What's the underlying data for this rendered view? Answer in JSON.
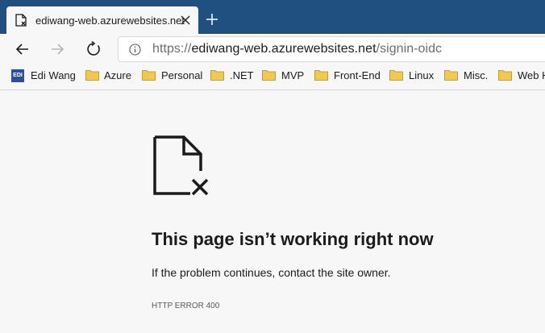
{
  "tab": {
    "title": "ediwang-web.azurewebsites.net",
    "icon": "page-icon",
    "close_icon": "close-icon"
  },
  "toolbar": {
    "back_icon": "back-arrow-icon",
    "forward_icon": "forward-arrow-icon",
    "refresh_icon": "refresh-icon",
    "info_icon": "info-icon"
  },
  "address": {
    "protocol": "https://",
    "host": "ediwang-web.azurewebsites.net",
    "path": "/signin-oidc"
  },
  "bookmarks": [
    {
      "label": "Edi Wang",
      "icon": "edi-logo",
      "logo_text": "EDI"
    },
    {
      "label": "Azure",
      "icon": "folder-icon"
    },
    {
      "label": "Personal",
      "icon": "folder-icon"
    },
    {
      "label": ".NET",
      "icon": "folder-icon"
    },
    {
      "label": "MVP",
      "icon": "folder-icon"
    },
    {
      "label": "Front-End",
      "icon": "folder-icon"
    },
    {
      "label": "Linux",
      "icon": "folder-icon"
    },
    {
      "label": "Misc.",
      "icon": "folder-icon"
    },
    {
      "label": "Web H",
      "icon": "folder-icon"
    }
  ],
  "error": {
    "icon": "broken-page-icon",
    "title": "This page isn’t working right now",
    "message": "If the problem continues, contact the site owner.",
    "code": "HTTP ERROR 400"
  },
  "colors": {
    "tabstrip": "#1f5080",
    "background": "#f7f7f7",
    "folder": "#f2c94c"
  }
}
